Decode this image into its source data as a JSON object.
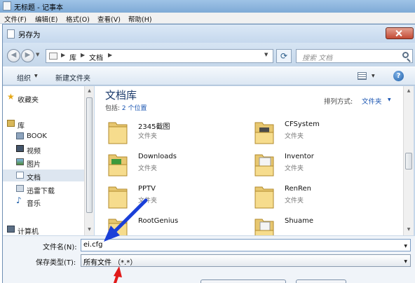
{
  "notepad": {
    "title": "无标题 - 记事本",
    "menu": [
      "文件(F)",
      "编辑(E)",
      "格式(O)",
      "查看(V)",
      "帮助(H)"
    ]
  },
  "dialog": {
    "title": "另存为",
    "address": [
      "库",
      "文档"
    ],
    "search_placeholder": "搜索 文档",
    "toolbar": {
      "organize": "组织",
      "new_folder": "新建文件夹"
    },
    "nav": {
      "favorites": "收藏夹",
      "libraries": "库",
      "items": [
        "BOOK",
        "视频",
        "图片",
        "文档",
        "迅雷下载",
        "音乐"
      ],
      "computer": "计算机"
    },
    "library": {
      "title": "文档库",
      "includes_label": "包括:",
      "includes_link": "2 个位置",
      "arrange_label": "排列方式:",
      "arrange_value": "文件夹"
    },
    "files": [
      {
        "name": "2345截图",
        "type": "文件夹"
      },
      {
        "name": "CFSystem",
        "type": "文件夹"
      },
      {
        "name": "Downloads",
        "type": "文件夹"
      },
      {
        "name": "Inventor",
        "type": "文件夹"
      },
      {
        "name": "PPTV",
        "type": "文件夹"
      },
      {
        "name": "RenRen",
        "type": "文件夹"
      },
      {
        "name": "RootGenius",
        "type": ""
      },
      {
        "name": "Shuame",
        "type": ""
      }
    ],
    "filename_label": "文件名(N):",
    "filename_value": "ei.cfg",
    "filetype_label": "保存类型(T):",
    "filetype_value": "所有文件 （*.*）"
  },
  "colors": {
    "accent": "#1a55b2",
    "title_bar": "#c5d7ea",
    "annotation_blue": "#1a3fd8",
    "annotation_red": "#e11a1a"
  }
}
